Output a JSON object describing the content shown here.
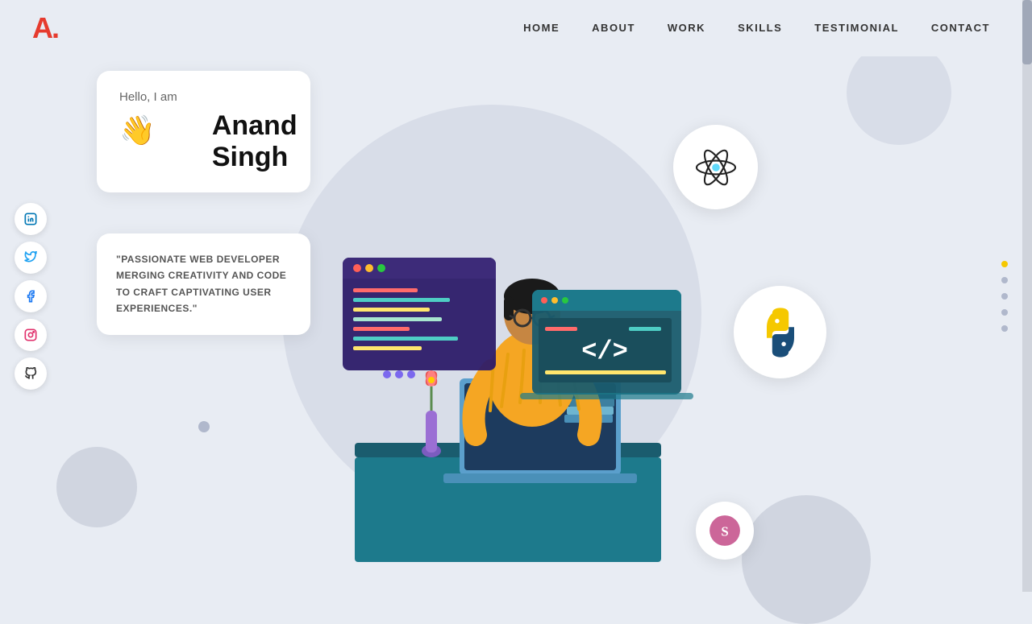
{
  "logo": {
    "letter": "A",
    "dot": "."
  },
  "nav": {
    "links": [
      {
        "label": "HOME",
        "href": "#home"
      },
      {
        "label": "ABOUT",
        "href": "#about"
      },
      {
        "label": "WORK",
        "href": "#work"
      },
      {
        "label": "SKILLS",
        "href": "#skills"
      },
      {
        "label": "TESTIMONIAL",
        "href": "#testimonial"
      },
      {
        "label": "CONTACT",
        "href": "#contact"
      }
    ]
  },
  "hero": {
    "greeting": "Hello, I am",
    "name": "Anand Singh",
    "wave_emoji": "👋",
    "quote": "\"PASSIONATE WEB DEVELOPER MERGING CREATIVITY AND CODE TO CRAFT CAPTIVATING USER EXPERIENCES.\""
  },
  "social": {
    "icons": [
      {
        "name": "linkedin",
        "symbol": "in"
      },
      {
        "name": "twitter",
        "symbol": "🐦"
      },
      {
        "name": "facebook",
        "symbol": "f"
      },
      {
        "name": "instagram",
        "symbol": "◎"
      },
      {
        "name": "github",
        "symbol": "⎇"
      }
    ]
  },
  "page_dots": {
    "count": 5,
    "active": 0
  },
  "tech_icons": [
    {
      "name": "react",
      "label": "React"
    },
    {
      "name": "python",
      "label": "Python"
    },
    {
      "name": "sass",
      "label": "Sass"
    }
  ]
}
